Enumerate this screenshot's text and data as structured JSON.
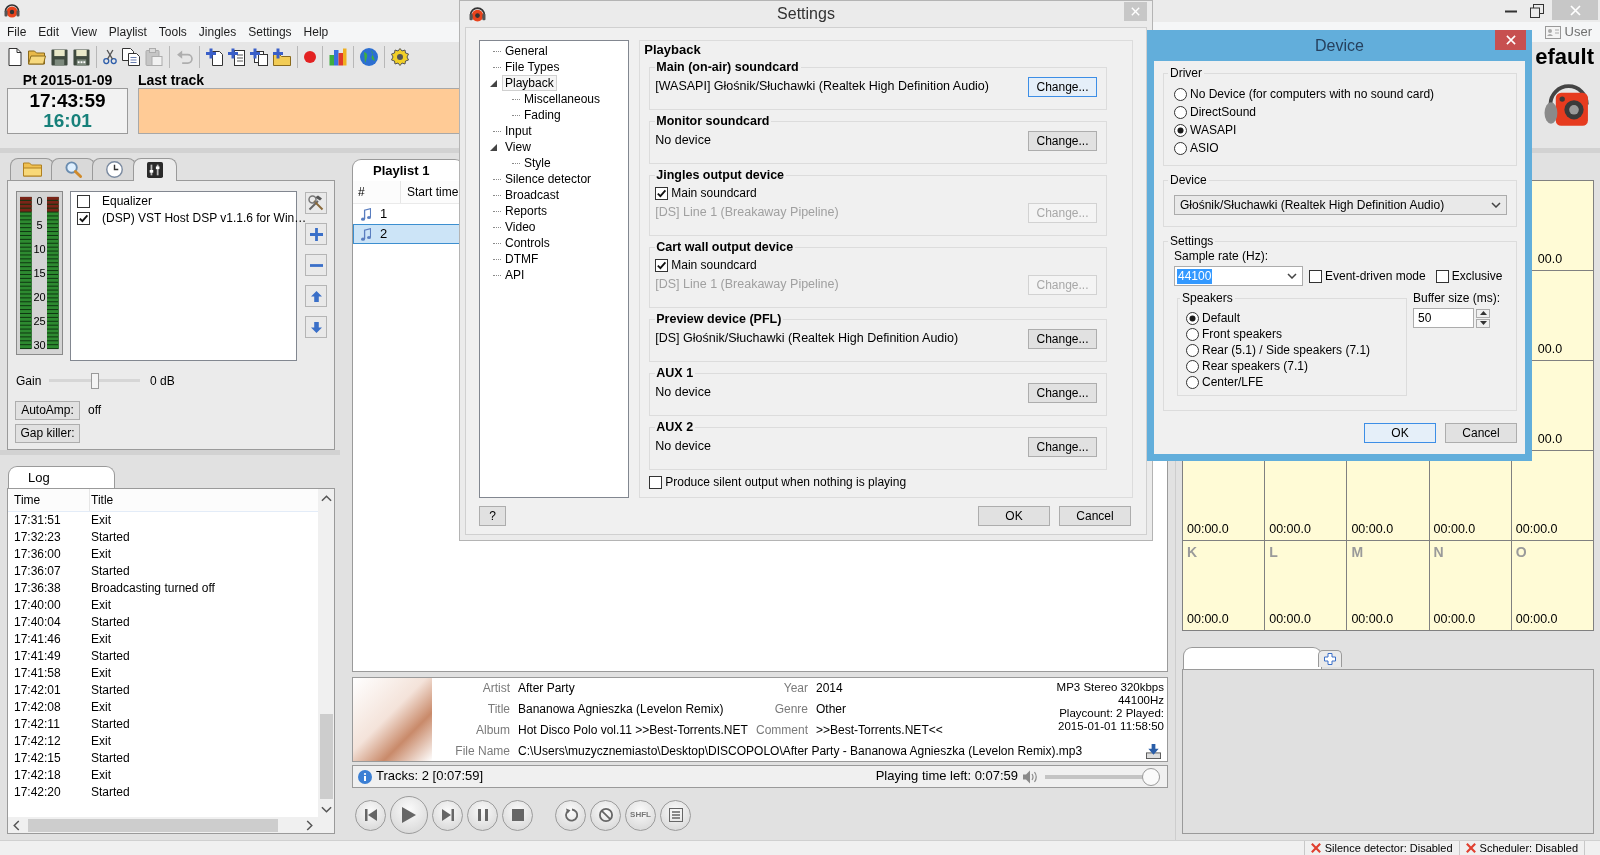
{
  "main_window": {
    "menu": [
      "File",
      "Edit",
      "View",
      "Playlist",
      "Tools",
      "Jingles",
      "Settings",
      "Help"
    ],
    "user": "User",
    "toolbar_groups": [
      {
        "buttons": [
          {
            "disabled": false
          },
          {
            "disabled": false
          },
          {
            "disabled": false
          },
          {
            "disabled": false
          }
        ]
      },
      {
        "buttons": [
          {
            "disabled": false
          },
          {
            "disabled": false
          },
          {
            "disabled": true
          }
        ]
      },
      {
        "buttons": [
          {
            "disabled": true
          }
        ]
      },
      {
        "buttons": [
          {
            "disabled": false
          },
          {
            "disabled": false
          },
          {
            "disabled": false
          },
          {
            "disabled": false
          }
        ]
      },
      {
        "buttons": [
          {
            "disabled": false
          }
        ]
      },
      {
        "buttons": [
          {
            "disabled": false
          }
        ]
      },
      {
        "buttons": [
          {
            "disabled": false
          }
        ]
      },
      {
        "buttons": [
          {
            "disabled": false
          }
        ]
      }
    ],
    "profile": "efault",
    "date": "Pt 2015-01-09",
    "clock": {
      "time": "17:43:59",
      "countdown": "16:01"
    },
    "last_track": {
      "label": "Last track"
    }
  },
  "library": {
    "tabs": [
      {
        "selected": false
      },
      {
        "selected": false
      },
      {
        "selected": false
      },
      {
        "selected": true
      }
    ],
    "vu_scale": [
      "0",
      "5",
      "10",
      "15",
      "20",
      "25",
      "30"
    ],
    "dsp_plugins": [
      {
        "label": "Equalizer",
        "checked": false
      },
      {
        "label": "(DSP) VST Host DSP v1.1.6 for Win…",
        "checked": true
      }
    ],
    "gain": {
      "label": "Gain",
      "level": 0.5,
      "reading": "0 dB"
    },
    "autoamp": {
      "button": "AutoAmp:",
      "value": "off"
    },
    "gap_killer": {
      "button": "Gap killer:"
    }
  },
  "log": {
    "tab": "Log",
    "columns": [
      "Time",
      "Title"
    ],
    "rows": [
      {
        "time": "17:31:51",
        "title": "Exit"
      },
      {
        "time": "17:32:23",
        "title": "Started"
      },
      {
        "time": "17:36:00",
        "title": "Exit"
      },
      {
        "time": "17:36:07",
        "title": "Started"
      },
      {
        "time": "17:36:38",
        "title": "Broadcasting turned off"
      },
      {
        "time": "17:40:00",
        "title": "Exit"
      },
      {
        "time": "17:40:04",
        "title": "Started"
      },
      {
        "time": "17:41:46",
        "title": "Exit"
      },
      {
        "time": "17:41:49",
        "title": "Started"
      },
      {
        "time": "17:41:58",
        "title": "Exit"
      },
      {
        "time": "17:42:01",
        "title": "Started"
      },
      {
        "time": "17:42:08",
        "title": "Exit"
      },
      {
        "time": "17:42:11",
        "title": "Started"
      },
      {
        "time": "17:42:12",
        "title": "Exit"
      },
      {
        "time": "17:42:15",
        "title": "Started"
      },
      {
        "time": "17:42:18",
        "title": "Exit"
      },
      {
        "time": "17:42:20",
        "title": "Started"
      }
    ]
  },
  "playlist": {
    "tab": "Playlist 1",
    "columns": [
      "#",
      "Start time"
    ],
    "rows": [
      {
        "number": "1",
        "selected": false
      },
      {
        "number": "2",
        "selected": true
      }
    ]
  },
  "track_info": {
    "fields": [
      {
        "label": "Artist",
        "value": "After Party"
      },
      {
        "label": "Title",
        "value": "Bananowa Agnieszka (Levelon Remix)"
      },
      {
        "label": "Album",
        "value": "Hot Disco Polo vol.11 >>Best-Torrents.NET"
      }
    ],
    "extra_fields": [
      {
        "label": "Year",
        "value": "2014"
      },
      {
        "label": "Genre",
        "value": "Other"
      },
      {
        "label": "Comment",
        "value": ">>Best-Torrents.NET<<"
      }
    ],
    "file": {
      "label": "File Name",
      "value": "C:\\Users\\muzycznemiasto\\Desktop\\DISCOPOLO\\After Party - Bananowa Agnieszka (Levelon Remix).mp3"
    },
    "format": [
      "MP3 Stereo 320kbps",
      "44100Hz",
      "Playcount: 2  Played:",
      "2015-01-01 11:58:50"
    ]
  },
  "player": {
    "tracks": "Tracks: 2 [0:07:59]",
    "time_left": "Playing time left: 0:07:59",
    "volume": {
      "level": 1
    },
    "shuffle_label": "SHFL"
  },
  "cart_wall": {
    "rows": [
      {
        "cells": [
          {
            "time": "00.0",
            "cut_off": true
          }
        ]
      },
      {
        "cells": [
          {
            "time": "00.0",
            "cut_off": true
          }
        ]
      },
      {
        "cells": [
          {
            "time": "00.0",
            "cut_off": true
          }
        ]
      },
      {
        "cells": [
          {
            "time": "00:00.0",
            "cut_off": false
          },
          {
            "time": "00:00.0",
            "cut_off": false
          },
          {
            "time": "00:00.0",
            "cut_off": false
          },
          {
            "time": "00:00.0",
            "cut_off": false
          },
          {
            "time": "00:00.0",
            "cut_off": false
          }
        ]
      },
      {
        "cells": [
          {
            "label": "K",
            "time": "00:00.0",
            "cut_off": false
          },
          {
            "label": "L",
            "time": "00:00.0",
            "cut_off": false
          },
          {
            "label": "M",
            "time": "00:00.0",
            "cut_off": false
          },
          {
            "label": "N",
            "time": "00:00.0",
            "cut_off": false
          },
          {
            "label": "O",
            "time": "00:00.0",
            "cut_off": false
          }
        ]
      }
    ]
  },
  "bottom_tabs": [
    {
      "selected": true
    }
  ],
  "status_bar": [
    "Silence detector: Disabled",
    "Scheduler: Disabled"
  ],
  "settings": {
    "title": "Settings",
    "tree": [
      {
        "label": "General",
        "selected": false
      },
      {
        "label": "File Types",
        "selected": false
      },
      {
        "label": "Playback",
        "selected": true,
        "expanded": true,
        "children": [
          {
            "label": "Miscellaneous",
            "selected": false
          },
          {
            "label": "Fading",
            "selected": false
          }
        ]
      },
      {
        "label": "Input",
        "selected": false
      },
      {
        "label": "View",
        "selected": false,
        "expanded": true,
        "children": [
          {
            "label": "Style",
            "selected": false
          }
        ]
      },
      {
        "label": "Silence detector",
        "selected": false
      },
      {
        "label": "Broadcast",
        "selected": false
      },
      {
        "label": "Reports",
        "selected": false
      },
      {
        "label": "Video",
        "selected": false
      },
      {
        "label": "Controls",
        "selected": false
      },
      {
        "label": "DTMF",
        "selected": false
      },
      {
        "label": "API",
        "selected": false
      }
    ],
    "page_title": "Playback",
    "groups": [
      {
        "title": "Main (on-air) soundcard",
        "device": "[WASAPI] Głośnik/Słuchawki (Realtek High Definition Audio)",
        "button": "Change...",
        "focused": true,
        "disabled": false
      },
      {
        "title": "Monitor soundcard",
        "device": "No device",
        "button": "Change...",
        "focused": false,
        "disabled": false
      },
      {
        "title": "Jingles output device",
        "use_main": {
          "label": "Main soundcard",
          "checked": true
        },
        "device": "[DS] Line 1 (Breakaway Pipeline)",
        "button": "Change...",
        "focused": false,
        "disabled": true
      },
      {
        "title": "Cart wall output device",
        "use_main": {
          "label": "Main soundcard",
          "checked": true
        },
        "device": "[DS] Line 1 (Breakaway Pipeline)",
        "button": "Change...",
        "focused": false,
        "disabled": true
      },
      {
        "title": "Preview device (PFL)",
        "device": "[DS] Głośnik/Słuchawki (Realtek High Definition Audio)",
        "button": "Change...",
        "focused": false,
        "disabled": false
      },
      {
        "title": "AUX 1",
        "device": "No device",
        "button": "Change...",
        "focused": false,
        "disabled": false
      },
      {
        "title": "AUX 2",
        "device": "No device",
        "button": "Change...",
        "focused": false,
        "disabled": false
      }
    ],
    "silent_output": {
      "label": "Produce silent output when nothing is playing",
      "checked": false
    },
    "help_button": "?",
    "ok_button": "OK",
    "cancel_button": "Cancel"
  },
  "device": {
    "title": "Device",
    "driver_legend": "Driver",
    "drivers": [
      {
        "label": "No Device (for computers with no sound card)",
        "selected": false
      },
      {
        "label": "DirectSound",
        "selected": false
      },
      {
        "label": "WASAPI",
        "selected": true
      },
      {
        "label": "ASIO",
        "selected": false
      }
    ],
    "device_legend": "Device",
    "device_value": "Głośnik/Słuchawki (Realtek High Definition Audio)",
    "settings_legend": "Settings",
    "sample_rate_label": "Sample rate (Hz):",
    "sample_rate": "44100",
    "event_driven": {
      "label": "Event-driven mode",
      "checked": false
    },
    "exclusive": {
      "label": "Exclusive",
      "checked": false
    },
    "speakers_legend": "Speakers",
    "speakers": [
      {
        "label": "Default",
        "selected": true
      },
      {
        "label": "Front speakers",
        "selected": false
      },
      {
        "label": "Rear (5.1) / Side speakers (7.1)",
        "selected": false
      },
      {
        "label": "Rear speakers (7.1)",
        "selected": false
      },
      {
        "label": "Center/LFE",
        "selected": false
      }
    ],
    "buffer_label": "Buffer size (ms):",
    "buffer": "50",
    "buttons": [
      {
        "label": "OK",
        "focused": true
      },
      {
        "label": "Cancel",
        "focused": false
      }
    ]
  }
}
